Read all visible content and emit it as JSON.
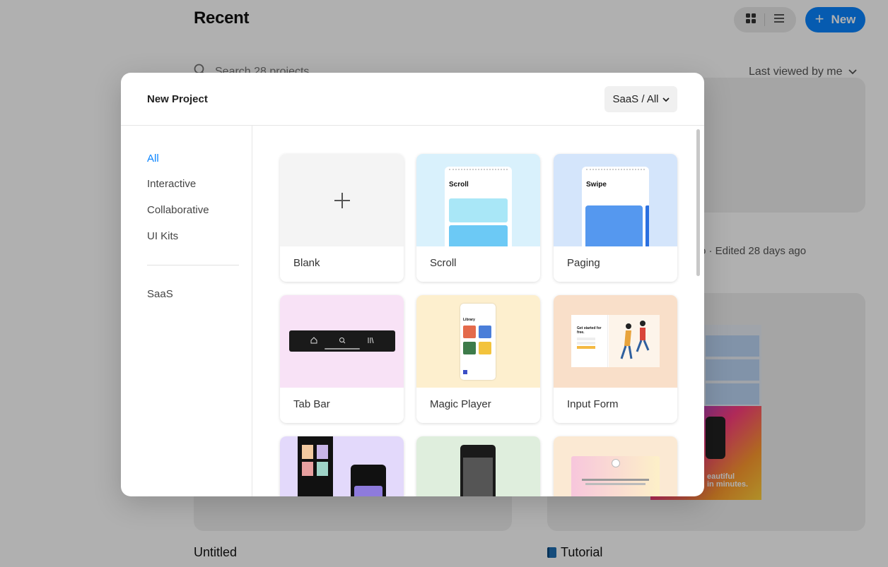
{
  "page": {
    "title": "Recent",
    "new_button": "New",
    "search_placeholder": "Search 28 projects",
    "sort_label": "Last viewed by me",
    "edited_text": "o · Edited 28 days ago",
    "project1_name": "Untitled",
    "project2_name": "Tutorial",
    "preview_text": "eautiful\nin minutes."
  },
  "modal": {
    "title": "New Project",
    "filter_label": "SaaS / All",
    "sidebar": {
      "categories": [
        "All",
        "Interactive",
        "Collaborative",
        "UI Kits"
      ],
      "teams": [
        "SaaS"
      ]
    },
    "templates": [
      {
        "label": "Blank"
      },
      {
        "label": "Scroll",
        "thumb_title": "Scroll"
      },
      {
        "label": "Paging",
        "thumb_title": "Swipe"
      },
      {
        "label": "Tab Bar"
      },
      {
        "label": "Magic Player",
        "thumb_title": "Library"
      },
      {
        "label": "Input Form",
        "thumb_title": "Get started for free."
      }
    ]
  },
  "colors": {
    "accent": "#0a84ff",
    "overlay": "rgba(0,0,0,0.31)"
  }
}
